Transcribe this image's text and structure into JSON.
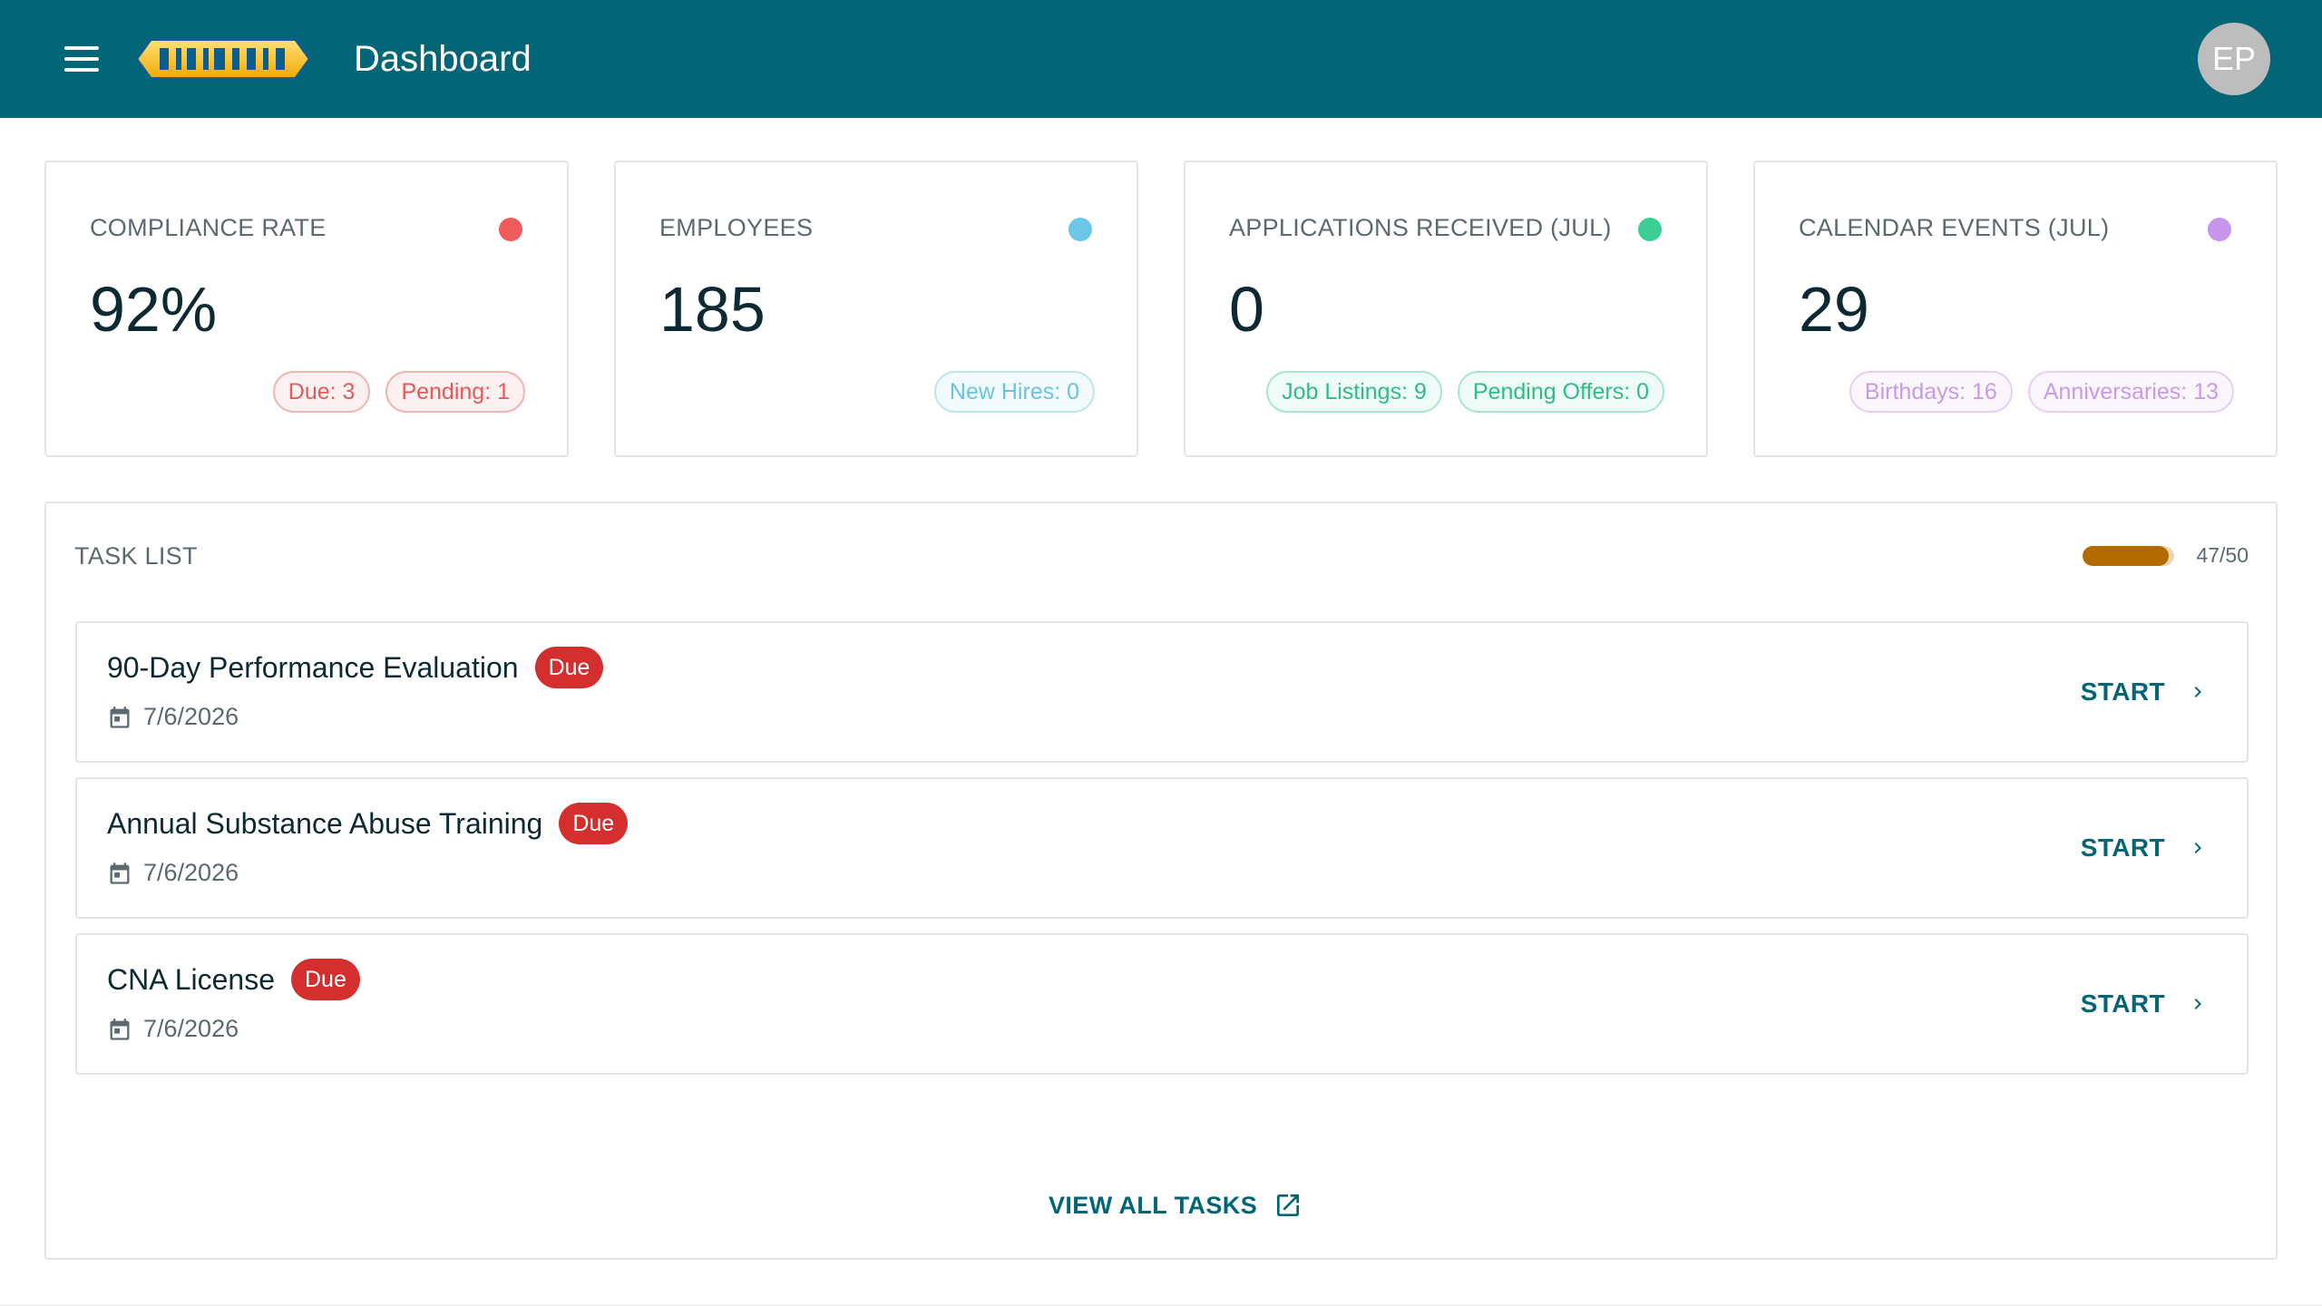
{
  "header": {
    "title": "Dashboard",
    "avatar_initials": "EP",
    "brand_color": "#026677"
  },
  "cards": [
    {
      "title": "COMPLIANCE RATE",
      "value": "92%",
      "dot_color": "#ef5b5b",
      "chips": [
        {
          "label": "Due: 3",
          "style": "red"
        },
        {
          "label": "Pending: 1",
          "style": "red"
        }
      ]
    },
    {
      "title": "EMPLOYEES",
      "value": "185",
      "dot_color": "#6ec6e6",
      "chips": [
        {
          "label": "New Hires: 0",
          "style": "blue"
        }
      ]
    },
    {
      "title": "APPLICATIONS RECEIVED (JUL)",
      "value": "0",
      "dot_color": "#3ccf93",
      "chips": [
        {
          "label": "Job Listings: 9",
          "style": "green"
        },
        {
          "label": "Pending Offers: 0",
          "style": "green"
        }
      ]
    },
    {
      "title": "CALENDAR EVENTS (JUL)",
      "value": "29",
      "dot_color": "#c795ec",
      "chips": [
        {
          "label": "Birthdays: 16",
          "style": "purple"
        },
        {
          "label": "Anniversaries: 13",
          "style": "purple"
        }
      ]
    }
  ],
  "task_list": {
    "title": "TASK LIST",
    "progress_text": "47/50",
    "progress_value": 47,
    "progress_max": 50,
    "progress_color": "#b36b00",
    "items": [
      {
        "name": "90-Day Performance Evaluation",
        "badge": "Due",
        "date": "7/6/2026",
        "action": "START"
      },
      {
        "name": "Annual Substance Abuse Training",
        "badge": "Due",
        "date": "7/6/2026",
        "action": "START"
      },
      {
        "name": "CNA License",
        "badge": "Due",
        "date": "7/6/2026",
        "action": "START"
      }
    ],
    "view_all_label": "VIEW ALL TASKS"
  }
}
